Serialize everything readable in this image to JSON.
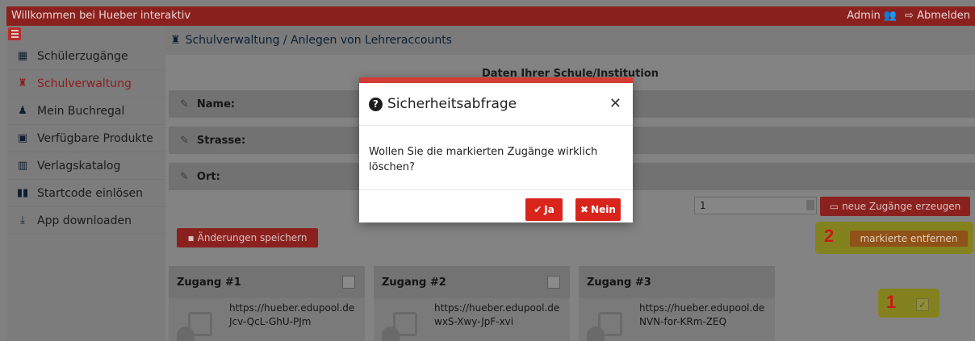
{
  "topbar": {
    "welcome": "Willkommen bei Hueber interaktiv",
    "user": "Admin",
    "logout": "Abmelden"
  },
  "sidebar": {
    "items": [
      {
        "label": "Schülerzugänge",
        "icon": "students-icon"
      },
      {
        "label": "Schulverwaltung",
        "icon": "school-admin-icon"
      },
      {
        "label": "Mein Buchregal",
        "icon": "bookshelf-user-icon"
      },
      {
        "label": "Verfügbare Produkte",
        "icon": "book-icon"
      },
      {
        "label": "Verlagskatalog",
        "icon": "catalog-icon"
      },
      {
        "label": "Startcode einlösen",
        "icon": "barcode-icon"
      },
      {
        "label": "App downloaden",
        "icon": "download-icon"
      }
    ]
  },
  "breadcrumb": "Schulverwaltung / Anlegen von Lehreraccounts",
  "form": {
    "heading": "Daten Ihrer Schule/Institution",
    "fields": [
      "Name:",
      "Strasse:",
      "Ort:"
    ],
    "count_value": "1",
    "generate_label": "neue Zugänge erzeugen",
    "save_label": "Änderungen speichern",
    "remove_label": "markierte entfernen"
  },
  "annotations": {
    "one": "1",
    "two": "2"
  },
  "cards": [
    {
      "title": "Zugang #1",
      "url": "https://hueber.edupool.de",
      "code": "Jcv-QcL-GhU-PJm",
      "checked": false
    },
    {
      "title": "Zugang #2",
      "url": "https://hueber.edupool.de",
      "code": "wxS-Xwy-JpF-xvi",
      "checked": false
    },
    {
      "title": "Zugang #3",
      "url": "https://hueber.edupool.de",
      "code": "NVN-for-KRm-ZEQ",
      "checked": true
    }
  ],
  "modal": {
    "title": "Sicherheitsabfrage",
    "body": "Wollen Sie die markierten Zugänge wirklich löschen?",
    "yes": "Ja",
    "no": "Nein"
  },
  "colors": {
    "brand": "#8b211e",
    "accent_red": "#d9241c",
    "highlight": "#f0ec3a"
  }
}
